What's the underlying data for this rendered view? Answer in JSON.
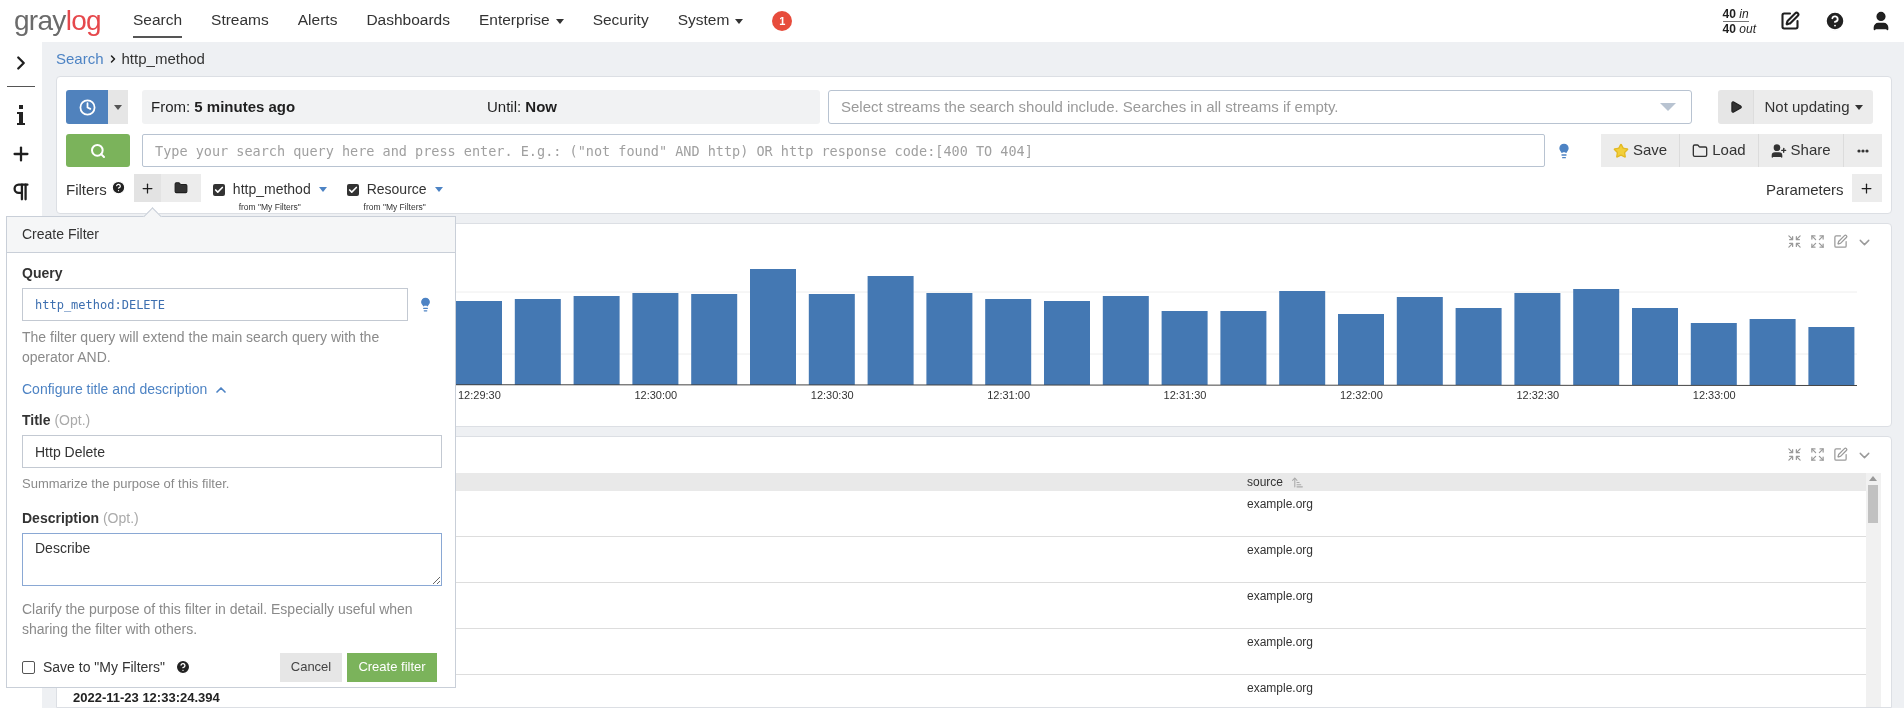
{
  "nav": {
    "logo_first": "gray",
    "logo_second": "log",
    "items": [
      {
        "label": "Search",
        "selected": true,
        "dropdown": false
      },
      {
        "label": "Streams",
        "selected": false,
        "dropdown": false
      },
      {
        "label": "Alerts",
        "selected": false,
        "dropdown": false
      },
      {
        "label": "Dashboards",
        "selected": false,
        "dropdown": false
      },
      {
        "label": "Enterprise",
        "selected": false,
        "dropdown": true
      },
      {
        "label": "Security",
        "selected": false,
        "dropdown": false
      },
      {
        "label": "System",
        "selected": false,
        "dropdown": true
      }
    ],
    "badge": "1",
    "in_value": "40",
    "in_label": "in",
    "out_value": "40",
    "out_label": "out"
  },
  "breadcrumb": {
    "parent": "Search",
    "current": "http_method"
  },
  "search_bar": {
    "from_label": "From:",
    "from": "5 minutes ago",
    "until_label": "Until:",
    "until": "Now",
    "streams_placeholder": "Select streams the search should include. Searches in all streams if empty.",
    "refresh": "Not updating",
    "query_placeholder": "Type your search query here and press enter. E.g.: (\"not found\" AND http) OR http response code:[400 TO 404]",
    "actions": [
      "Save",
      "Load",
      "Share"
    ]
  },
  "filters": {
    "label": "Filters",
    "parameters": "Parameters",
    "items": [
      {
        "title": "http_method",
        "source": "from \"My Filters\"",
        "checked": true
      },
      {
        "title": "Resource",
        "source": "from \"My Filters\"",
        "checked": true
      }
    ]
  },
  "histogram": {
    "time_labels": [
      "12:29:30",
      "12:30:00",
      "12:30:30",
      "12:31:00",
      "12:31:30",
      "12:32:00",
      "12:32:30",
      "12:33:00"
    ]
  },
  "messages": {
    "columns": [
      {
        "label": "source"
      }
    ],
    "rows": [
      {
        "source": "example.org"
      },
      {
        "source": "example.org"
      },
      {
        "source": "example.org"
      },
      {
        "source": "example.org"
      },
      {
        "timestamp": "2022-11-23 12:33:24.394",
        "source": "example.org"
      }
    ]
  },
  "create_filter": {
    "title": "Create Filter",
    "query_label": "Query",
    "query_value": "http_method:DELETE",
    "query_help": "The filter query will extend the main search query with the operator AND.",
    "configure_link": "Configure title and description",
    "expanded": true,
    "title_label": "Title",
    "optional": "(Opt.)",
    "title_value": "Http Delete",
    "title_help": "Summarize the purpose of this filter.",
    "description_label": "Description",
    "description_optional": "(Opt.)",
    "description_value": "Describe",
    "description_help": "Clarify the purpose of this filter in detail. Especially useful when sharing the filter with others.",
    "save_label": "Save to \"My Filters\"",
    "save_checked": false,
    "cancel": "Cancel",
    "submit": "Create filter"
  }
}
